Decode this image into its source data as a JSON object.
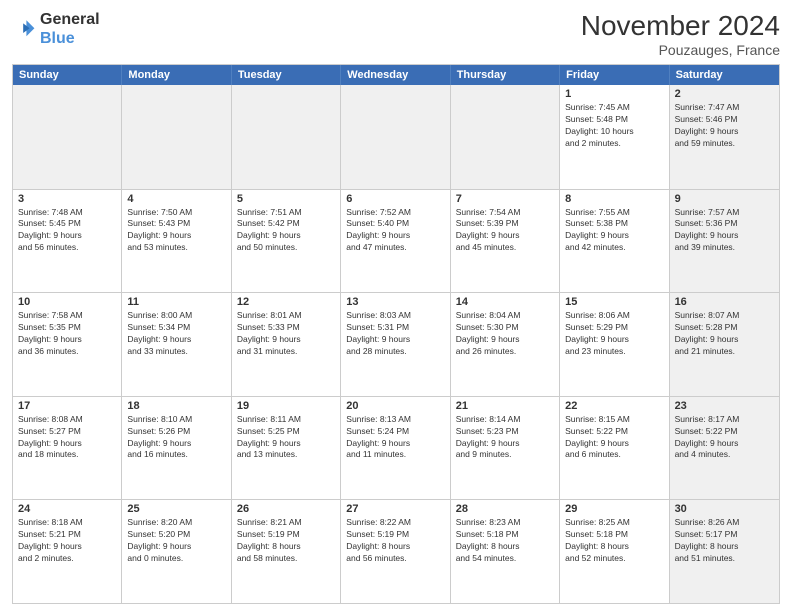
{
  "header": {
    "logo_line1": "General",
    "logo_line2": "Blue",
    "month": "November 2024",
    "location": "Pouzauges, France"
  },
  "day_headers": [
    "Sunday",
    "Monday",
    "Tuesday",
    "Wednesday",
    "Thursday",
    "Friday",
    "Saturday"
  ],
  "weeks": [
    [
      {
        "day": "",
        "info": "",
        "shaded": true
      },
      {
        "day": "",
        "info": "",
        "shaded": true
      },
      {
        "day": "",
        "info": "",
        "shaded": true
      },
      {
        "day": "",
        "info": "",
        "shaded": true
      },
      {
        "day": "",
        "info": "",
        "shaded": true
      },
      {
        "day": "1",
        "info": "Sunrise: 7:45 AM\nSunset: 5:48 PM\nDaylight: 10 hours\nand 2 minutes.",
        "shaded": false
      },
      {
        "day": "2",
        "info": "Sunrise: 7:47 AM\nSunset: 5:46 PM\nDaylight: 9 hours\nand 59 minutes.",
        "shaded": true
      }
    ],
    [
      {
        "day": "3",
        "info": "Sunrise: 7:48 AM\nSunset: 5:45 PM\nDaylight: 9 hours\nand 56 minutes.",
        "shaded": false
      },
      {
        "day": "4",
        "info": "Sunrise: 7:50 AM\nSunset: 5:43 PM\nDaylight: 9 hours\nand 53 minutes.",
        "shaded": false
      },
      {
        "day": "5",
        "info": "Sunrise: 7:51 AM\nSunset: 5:42 PM\nDaylight: 9 hours\nand 50 minutes.",
        "shaded": false
      },
      {
        "day": "6",
        "info": "Sunrise: 7:52 AM\nSunset: 5:40 PM\nDaylight: 9 hours\nand 47 minutes.",
        "shaded": false
      },
      {
        "day": "7",
        "info": "Sunrise: 7:54 AM\nSunset: 5:39 PM\nDaylight: 9 hours\nand 45 minutes.",
        "shaded": false
      },
      {
        "day": "8",
        "info": "Sunrise: 7:55 AM\nSunset: 5:38 PM\nDaylight: 9 hours\nand 42 minutes.",
        "shaded": false
      },
      {
        "day": "9",
        "info": "Sunrise: 7:57 AM\nSunset: 5:36 PM\nDaylight: 9 hours\nand 39 minutes.",
        "shaded": true
      }
    ],
    [
      {
        "day": "10",
        "info": "Sunrise: 7:58 AM\nSunset: 5:35 PM\nDaylight: 9 hours\nand 36 minutes.",
        "shaded": false
      },
      {
        "day": "11",
        "info": "Sunrise: 8:00 AM\nSunset: 5:34 PM\nDaylight: 9 hours\nand 33 minutes.",
        "shaded": false
      },
      {
        "day": "12",
        "info": "Sunrise: 8:01 AM\nSunset: 5:33 PM\nDaylight: 9 hours\nand 31 minutes.",
        "shaded": false
      },
      {
        "day": "13",
        "info": "Sunrise: 8:03 AM\nSunset: 5:31 PM\nDaylight: 9 hours\nand 28 minutes.",
        "shaded": false
      },
      {
        "day": "14",
        "info": "Sunrise: 8:04 AM\nSunset: 5:30 PM\nDaylight: 9 hours\nand 26 minutes.",
        "shaded": false
      },
      {
        "day": "15",
        "info": "Sunrise: 8:06 AM\nSunset: 5:29 PM\nDaylight: 9 hours\nand 23 minutes.",
        "shaded": false
      },
      {
        "day": "16",
        "info": "Sunrise: 8:07 AM\nSunset: 5:28 PM\nDaylight: 9 hours\nand 21 minutes.",
        "shaded": true
      }
    ],
    [
      {
        "day": "17",
        "info": "Sunrise: 8:08 AM\nSunset: 5:27 PM\nDaylight: 9 hours\nand 18 minutes.",
        "shaded": false
      },
      {
        "day": "18",
        "info": "Sunrise: 8:10 AM\nSunset: 5:26 PM\nDaylight: 9 hours\nand 16 minutes.",
        "shaded": false
      },
      {
        "day": "19",
        "info": "Sunrise: 8:11 AM\nSunset: 5:25 PM\nDaylight: 9 hours\nand 13 minutes.",
        "shaded": false
      },
      {
        "day": "20",
        "info": "Sunrise: 8:13 AM\nSunset: 5:24 PM\nDaylight: 9 hours\nand 11 minutes.",
        "shaded": false
      },
      {
        "day": "21",
        "info": "Sunrise: 8:14 AM\nSunset: 5:23 PM\nDaylight: 9 hours\nand 9 minutes.",
        "shaded": false
      },
      {
        "day": "22",
        "info": "Sunrise: 8:15 AM\nSunset: 5:22 PM\nDaylight: 9 hours\nand 6 minutes.",
        "shaded": false
      },
      {
        "day": "23",
        "info": "Sunrise: 8:17 AM\nSunset: 5:22 PM\nDaylight: 9 hours\nand 4 minutes.",
        "shaded": true
      }
    ],
    [
      {
        "day": "24",
        "info": "Sunrise: 8:18 AM\nSunset: 5:21 PM\nDaylight: 9 hours\nand 2 minutes.",
        "shaded": false
      },
      {
        "day": "25",
        "info": "Sunrise: 8:20 AM\nSunset: 5:20 PM\nDaylight: 9 hours\nand 0 minutes.",
        "shaded": false
      },
      {
        "day": "26",
        "info": "Sunrise: 8:21 AM\nSunset: 5:19 PM\nDaylight: 8 hours\nand 58 minutes.",
        "shaded": false
      },
      {
        "day": "27",
        "info": "Sunrise: 8:22 AM\nSunset: 5:19 PM\nDaylight: 8 hours\nand 56 minutes.",
        "shaded": false
      },
      {
        "day": "28",
        "info": "Sunrise: 8:23 AM\nSunset: 5:18 PM\nDaylight: 8 hours\nand 54 minutes.",
        "shaded": false
      },
      {
        "day": "29",
        "info": "Sunrise: 8:25 AM\nSunset: 5:18 PM\nDaylight: 8 hours\nand 52 minutes.",
        "shaded": false
      },
      {
        "day": "30",
        "info": "Sunrise: 8:26 AM\nSunset: 5:17 PM\nDaylight: 8 hours\nand 51 minutes.",
        "shaded": true
      }
    ]
  ]
}
